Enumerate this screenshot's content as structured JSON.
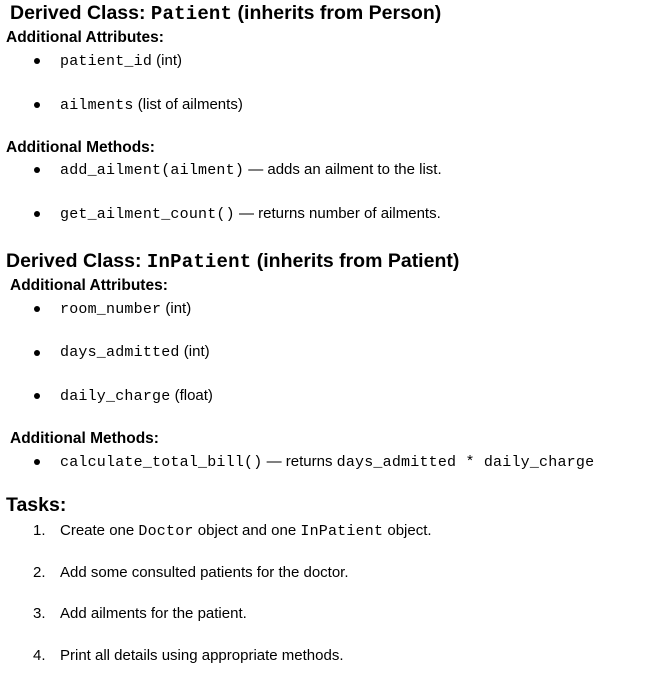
{
  "patient_section": {
    "heading_prefix": "Derived Class: ",
    "heading_code": "Patient",
    "heading_suffix": " (inherits from Person)",
    "attr_label": "Additional Attributes:",
    "attributes": [
      {
        "code": "patient_id",
        "desc": " (int)"
      },
      {
        "code": "ailments",
        "desc": " (list of ailments)"
      }
    ],
    "methods_label": "Additional Methods:",
    "methods": [
      {
        "code": "add_ailment(ailment)",
        "desc": " — adds an ailment to the list."
      },
      {
        "code": "get_ailment_count()",
        "desc": " — returns number of ailments."
      }
    ]
  },
  "inpatient_section": {
    "heading_prefix": "Derived Class: ",
    "heading_code": "InPatient",
    "heading_suffix": " (inherits from Patient)",
    "attr_label": "Additional Attributes:",
    "attributes": [
      {
        "code": "room_number",
        "desc": " (int)"
      },
      {
        "code": "days_admitted",
        "desc": " (int)"
      },
      {
        "code": "daily_charge",
        "desc": " (float)"
      }
    ],
    "methods_label": "Additional Methods:",
    "methods": [
      {
        "code": "calculate_total_bill()",
        "desc": " — returns ",
        "code2": "days_admitted * daily_charge"
      }
    ]
  },
  "tasks": {
    "heading": "Tasks:",
    "items": [
      {
        "num": "1.",
        "pre": "Create one ",
        "code1": "Doctor",
        "mid": " object and one ",
        "code2": "InPatient",
        "post": " object."
      },
      {
        "num": "2.",
        "text": "Add some consulted patients for the doctor."
      },
      {
        "num": "3.",
        "text": "Add ailments for the patient."
      },
      {
        "num": "4.",
        "text": "Print all details using appropriate methods."
      }
    ]
  }
}
